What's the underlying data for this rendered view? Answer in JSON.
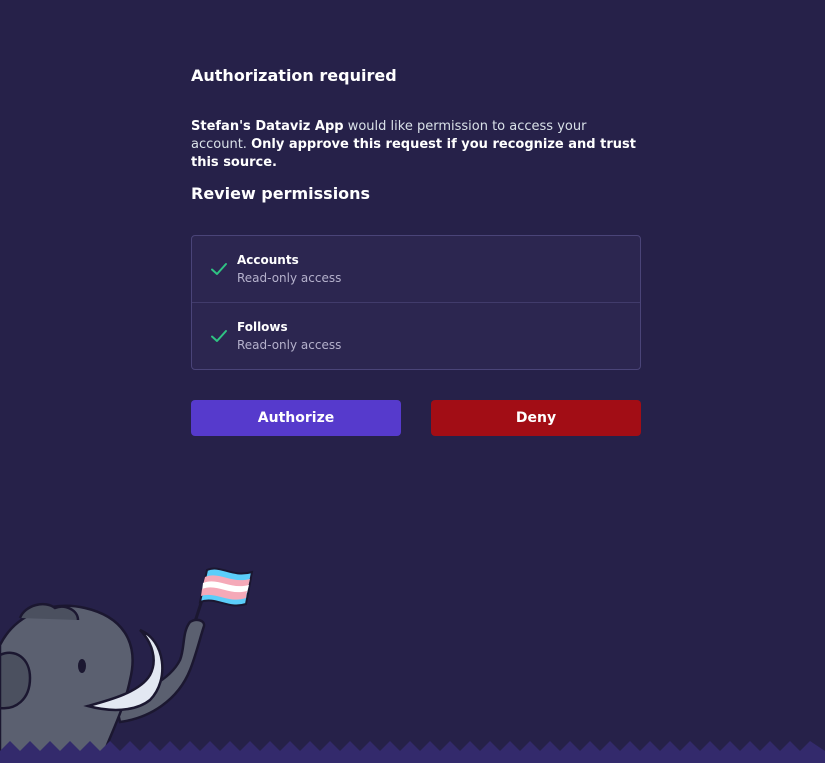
{
  "header": {
    "title": "Authorization required"
  },
  "request": {
    "app_name": "Stefan's Dataviz App",
    "message": " would like permission to access your account. ",
    "warning": "Only approve this request if you recognize and trust this source."
  },
  "permissions": {
    "title": "Review permissions",
    "items": [
      {
        "name": "Accounts",
        "description": "Read-only access",
        "icon": "check-icon"
      },
      {
        "name": "Follows",
        "description": "Read-only access",
        "icon": "check-icon"
      }
    ]
  },
  "actions": {
    "authorize_label": "Authorize",
    "deny_label": "Deny"
  },
  "colors": {
    "background": "#262149",
    "authorize": "#563acc",
    "deny": "#a20d15",
    "check": "#2fc383"
  }
}
